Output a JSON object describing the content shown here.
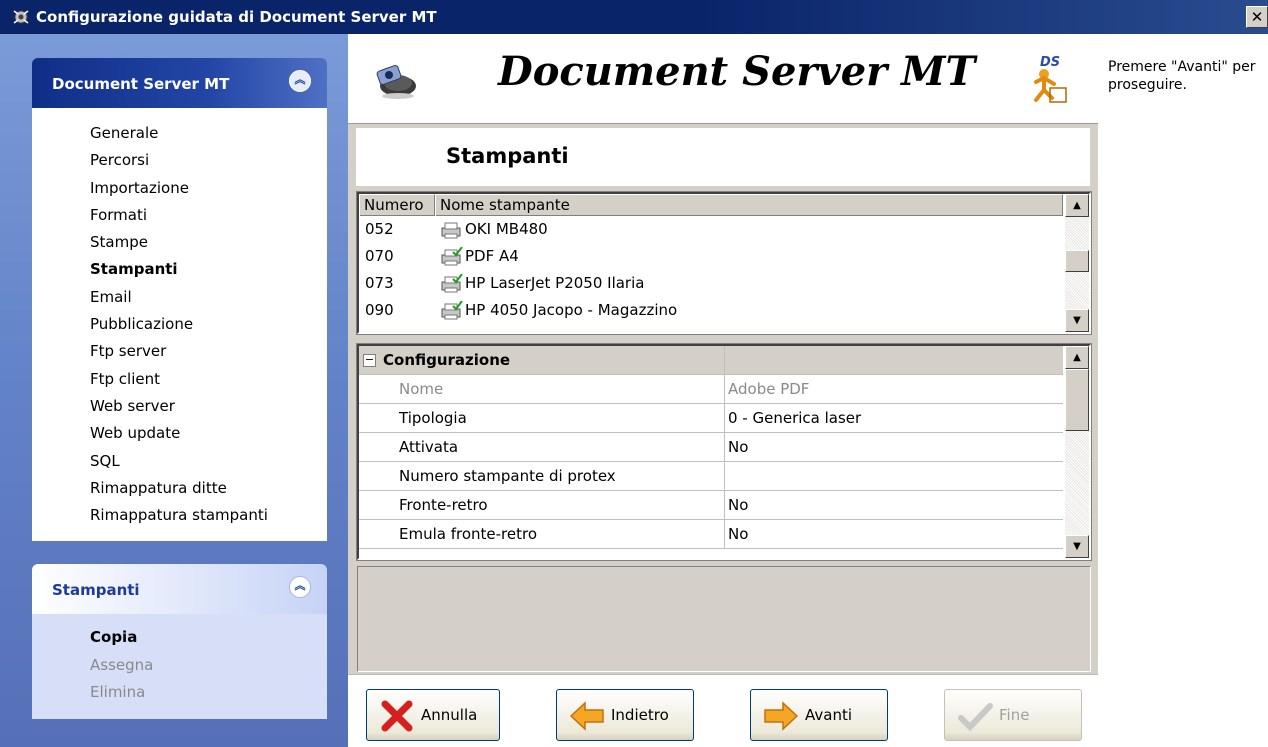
{
  "window": {
    "title": "Configurazione guidata di Document Server MT",
    "close_glyph": "✕"
  },
  "nav_panel": {
    "title": "Document Server MT",
    "items": [
      {
        "label": "Generale"
      },
      {
        "label": "Percorsi"
      },
      {
        "label": "Importazione"
      },
      {
        "label": "Formati"
      },
      {
        "label": "Stampe"
      },
      {
        "label": "Stampanti",
        "active": true
      },
      {
        "label": "Email"
      },
      {
        "label": "Pubblicazione"
      },
      {
        "label": "Ftp server"
      },
      {
        "label": "Ftp client"
      },
      {
        "label": "Web server"
      },
      {
        "label": "Web update"
      },
      {
        "label": "SQL"
      },
      {
        "label": "Rimappatura ditte"
      },
      {
        "label": "Rimappatura stampanti"
      }
    ]
  },
  "actions_panel": {
    "title": "Stampanti",
    "items": [
      {
        "label": "Copia",
        "enabled": true
      },
      {
        "label": "Assegna",
        "enabled": false
      },
      {
        "label": "Elimina",
        "enabled": false
      }
    ]
  },
  "header": {
    "app_title": "Document Server MT",
    "logo_text": "DS"
  },
  "section_title": "Stampanti",
  "printer_list": {
    "columns": [
      "Numero",
      "Nome stampante"
    ],
    "rows": [
      {
        "numero": "052",
        "nome": "OKI MB480",
        "default": false
      },
      {
        "numero": "070",
        "nome": "PDF A4",
        "default": true
      },
      {
        "numero": "073",
        "nome": "HP LaserJet P2050 Ilaria",
        "default": true
      },
      {
        "numero": "090",
        "nome": "HP 4050 Jacopo - Magazzino",
        "default": true
      }
    ]
  },
  "properties": {
    "group": "Configurazione",
    "rows": [
      {
        "key": "Nome",
        "value": "Adobe PDF",
        "readonly": true
      },
      {
        "key": "Tipologia",
        "value": "0 - Generica laser"
      },
      {
        "key": "Attivata",
        "value": "No"
      },
      {
        "key": "Numero stampante di protex",
        "value": ""
      },
      {
        "key": "Fronte-retro",
        "value": "No"
      },
      {
        "key": "Emula fronte-retro",
        "value": "No"
      }
    ]
  },
  "buttons": {
    "cancel": "Annulla",
    "back": "Indietro",
    "next": "Avanti",
    "finish": "Fine"
  },
  "hint": "Premere \"Avanti\" per proseguire.",
  "scroll_arrows": {
    "up": "▲",
    "down": "▼"
  },
  "chevron_glyph": "︽",
  "expander_glyph": "−",
  "colors": {
    "title_bar": "#0a246a",
    "sidebar": "#6282c8",
    "panel_active": "#1c3b9a",
    "dialog_face": "#d4d0c8"
  }
}
